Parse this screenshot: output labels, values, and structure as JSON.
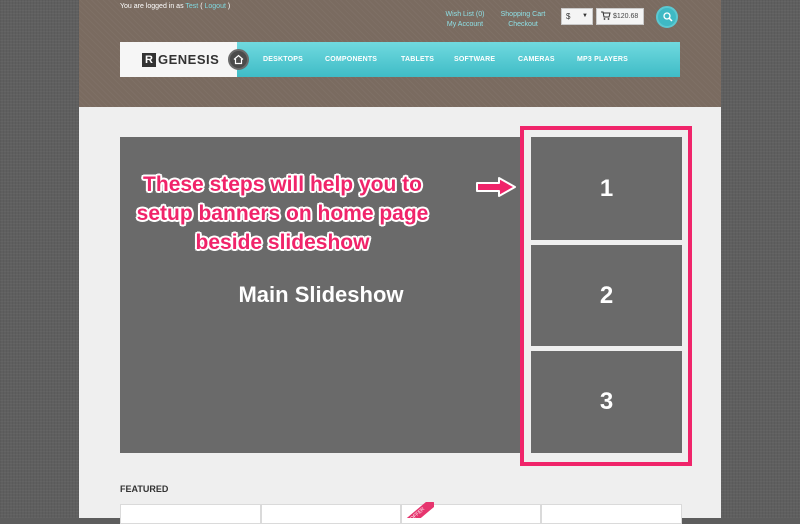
{
  "header": {
    "login_prefix": "You are logged in as",
    "username": "Test",
    "logout_open": "(",
    "logout_label": "Logout",
    "logout_close": ")",
    "wishlist": "Wish List (0)",
    "my_account": "My Account",
    "shopping_cart": "Shopping Cart",
    "checkout": "Checkout",
    "currency": "$",
    "cart_total": "$120.68"
  },
  "nav": {
    "logo_mark": "R",
    "logo_text": "GENESIS",
    "items": [
      "DESKTOPS",
      "COMPONENTS",
      "TABLETS",
      "SOFTWARE",
      "CAMERAS",
      "MP3 PLAYERS"
    ]
  },
  "main": {
    "slideshow_label": "Main Slideshow",
    "banners": [
      "1",
      "2",
      "3"
    ],
    "annotation_lines": [
      "These steps will help you to",
      "setup banners on home page",
      "beside slideshow"
    ],
    "featured_title": "FEATURED",
    "ribbon_text": "OFFER"
  },
  "colors": {
    "accent": "#4fc8d2",
    "highlight": "#f0246a",
    "header_bg": "#7a6b60",
    "placeholder_gray": "#6a6a6a"
  },
  "icons": {
    "search": "search-icon",
    "home": "home-icon",
    "cart": "cart-icon",
    "dropdown": "chevron-down-icon",
    "arrow": "arrow-right-icon"
  }
}
